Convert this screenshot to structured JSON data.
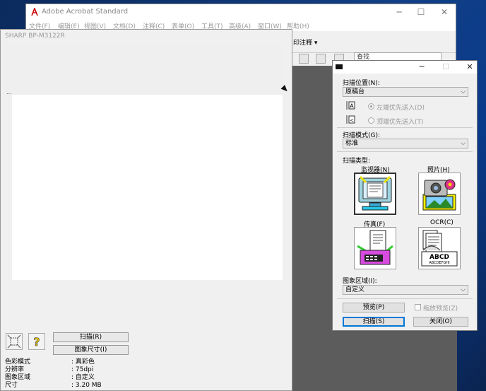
{
  "acrobat": {
    "title": "Adobe Acrobat Standard",
    "menu": [
      "文件(F)",
      "编辑(E)",
      "视图(V)",
      "文档(D)",
      "注释(C)",
      "表单(O)",
      "工具(T)",
      "高级(A)",
      "窗口(W)",
      "帮助(H)"
    ],
    "annotate_label": "印注释 ▾",
    "search_value": "查找"
  },
  "sharp": {
    "title": "SHARP BP-M3122R",
    "dots": "...",
    "scan_button": "扫描(R)",
    "image_size_button": "图象尺寸(I)",
    "info": [
      {
        "label": "色彩模式",
        "value": ": 真彩色"
      },
      {
        "label": "分辨率",
        "value": ": 75dpi"
      },
      {
        "label": "图象区域",
        "value": ": 自定义"
      },
      {
        "label": "尺寸",
        "value": ": 3.20 MB"
      }
    ]
  },
  "dialog": {
    "scan_position_label": "扫描位置(N):",
    "scan_position_value": "原稿台",
    "radio_left": "左端优先送入(D)",
    "radio_top": "顶端优先送入(T)",
    "scan_mode_label": "扫描模式(G):",
    "scan_mode_value": "标准",
    "scan_type_label": "扫描类型:",
    "types": [
      {
        "label": "监视器(N)",
        "icon": "monitor-icon"
      },
      {
        "label": "照片(H)",
        "icon": "photo-icon"
      },
      {
        "label": "传真(F)",
        "icon": "fax-icon"
      },
      {
        "label": "OCR(C)",
        "icon": "ocr-icon"
      }
    ],
    "image_area_label": "图象区域(I):",
    "image_area_value": "自定义",
    "preview_button": "预览(P)",
    "zoom_preview_label": "缩放预览(Z)",
    "scan_button": "扫描(S)",
    "close_button": "关闭(O)"
  }
}
